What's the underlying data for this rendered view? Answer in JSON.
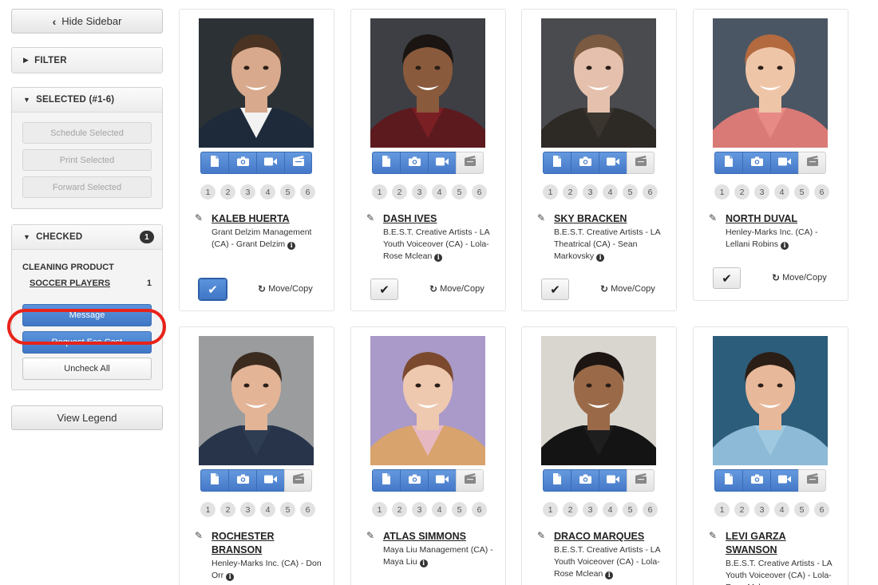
{
  "sidebar": {
    "hide_label": "Hide Sidebar",
    "filter_label": "FILTER",
    "selected_label": "SELECTED (#1-6)",
    "schedule_label": "Schedule Selected",
    "print_label": "Print Selected",
    "forward_label": "Forward Selected",
    "checked_label": "CHECKED",
    "checked_count": "1",
    "project_name": "CLEANING PRODUCT",
    "role_name": "SOCCER PLAYERS",
    "role_count": "1",
    "message_label": "Message",
    "eco_cast_label": "Request Eco Cast",
    "uncheck_label": "Uncheck All",
    "legend_label": "View Legend"
  },
  "card_common": {
    "move_copy": "Move/Copy",
    "numbers": [
      "1",
      "2",
      "3",
      "4",
      "5",
      "6"
    ],
    "check_glyph": "✔",
    "info_glyph": "i"
  },
  "cards": [
    {
      "name": "KALEB HUERTA",
      "agency": "Grant Delzim Management (CA) - Grant Delzim",
      "checked": true,
      "reel": true
    },
    {
      "name": "DASH IVES",
      "agency": "B.E.S.T. Creative Artists - LA Youth Voiceover (CA) - Lola-Rose Mclean",
      "checked": false,
      "reel": false
    },
    {
      "name": "SKY BRACKEN",
      "agency": "B.E.S.T. Creative Artists - LA Theatrical (CA) - Sean Markovsky",
      "checked": false,
      "reel": false
    },
    {
      "name": "NORTH DUVAL",
      "agency": "Henley-Marks Inc. (CA) - Lellani Robins",
      "checked": false,
      "reel": false
    },
    {
      "name": "ROCHESTER BRANSON",
      "agency": "Henley-Marks Inc. (CA) - Don Orr",
      "checked": false,
      "reel": false
    },
    {
      "name": "ATLAS SIMMONS",
      "agency": "Maya Liu Management (CA) - Maya Liu",
      "checked": false,
      "reel": false
    },
    {
      "name": "DRACO MARQUES",
      "agency": "B.E.S.T. Creative Artists - LA Youth Voiceover (CA) - Lola-Rose Mclean",
      "checked": false,
      "reel": false
    },
    {
      "name": "LEVI GARZA SWANSON",
      "agency": "B.E.S.T. Creative Artists - LA Youth Voiceover (CA) - Lola-Rose Mclean",
      "checked": false,
      "reel": false
    }
  ],
  "colors": {
    "accent": "#4a7fcb",
    "highlight": "#e8231a"
  }
}
